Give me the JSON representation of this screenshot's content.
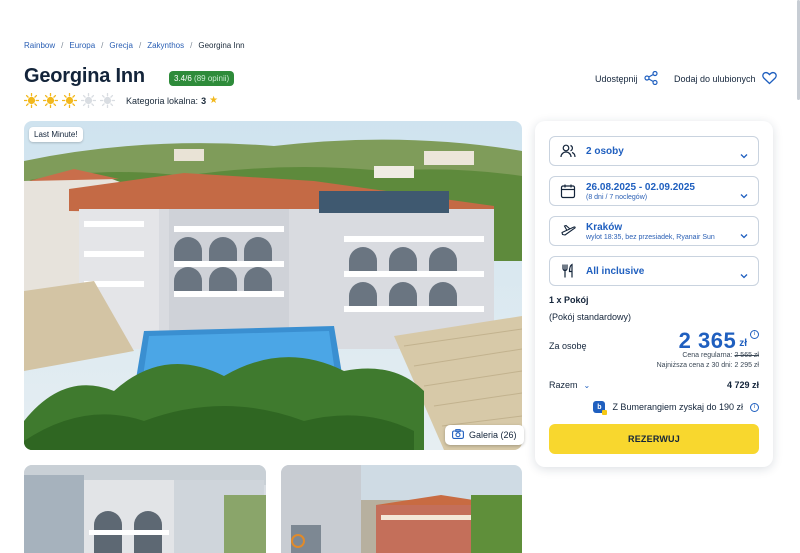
{
  "breadcrumb": {
    "items": [
      "Rainbow",
      "Europa",
      "Grecja",
      "Zakynthos"
    ],
    "current": "Georgina Inn",
    "separator": "/"
  },
  "hotel": {
    "name": "Georgina Inn",
    "rating": "3.4/6",
    "rating_count": "(89 opinii)",
    "suns_total": 5,
    "suns_filled": 3,
    "local_category_label": "Kategoria lokalna:",
    "local_category_value": "3"
  },
  "actions": {
    "share_label": "Udostępnij",
    "favorite_label": "Dodaj do ulubionych"
  },
  "photos": {
    "badge": "Last Minute!",
    "gallery_label": "Galeria (26)"
  },
  "booking": {
    "persons": "2 osoby",
    "dates": "26.08.2025 - 02.09.2025",
    "dates_sub": "(8 dni / 7 noclegów)",
    "departure_city": "Kraków",
    "departure_sub": "wylot 18:35, bez przesiadek, Ryanair Sun",
    "board": "All inclusive",
    "rooms": "1 x Pokój",
    "room_type": "(Pokój standardowy)",
    "per_person_label": "Za osobę",
    "price": "2 365",
    "currency": "zł",
    "regular_label": "Cena regularna:",
    "regular_price": "2 565 zł",
    "lowest_label": "Najniższa cena z 30 dni:",
    "lowest_price": "2 295 zł",
    "total_label": "Razem",
    "total_value": "4 729 zł",
    "bumerang_text": "Z Bumerangiem zyskaj do 190 zł",
    "reserve_label": "REZERWUJ"
  },
  "colors": {
    "brand_blue": "#1f5fbf",
    "reserve_yellow": "#f8d72e",
    "rating_green": "#2e8b3a",
    "sun_yellow": "#f2b81c"
  }
}
